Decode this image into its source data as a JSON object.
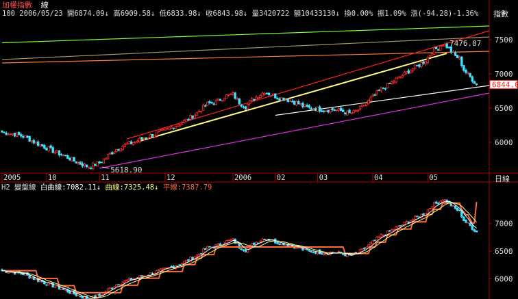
{
  "header": {
    "title": "加權指數",
    "mode": "線",
    "line1_prefix": "100",
    "date": "2006/05/23",
    "open": "開6874.09↓",
    "high": "高6909.58↓",
    "low": "低6833.98↓",
    "close": "收6843.98↓",
    "volume": "量3420722",
    "amount": "額10433130↓",
    "turnover": "換0.00%",
    "amplitude": "振1.09%",
    "change": "漲(-94.28)-1.36%",
    "right_tag": "指數"
  },
  "lower_header": {
    "panel_id": "H2",
    "name": "變盤線",
    "white_label": "白曲線:7082.11↓",
    "yellow_label": "曲線:7325.48↓",
    "red_label": "平線:7387.79"
  },
  "axis": {
    "x_unit_label": "日線",
    "x_ticks": [
      {
        "label": "2005",
        "index": 0
      },
      {
        "label": "10",
        "index": 21
      },
      {
        "label": "11",
        "index": 46
      },
      {
        "label": "12",
        "index": 77
      },
      {
        "label": "2006",
        "index": 109
      },
      {
        "label": "02",
        "index": 129
      },
      {
        "label": "03",
        "index": 149
      },
      {
        "label": "04",
        "index": 175
      },
      {
        "label": "05",
        "index": 201
      }
    ]
  },
  "annotations": {
    "low_label": "5618.90",
    "high_label": "7476.07",
    "last_price_tag": "6844.0"
  },
  "colors": {
    "up": "#ff3030",
    "down": "#40e0ff",
    "axis": "#b00000",
    "text_red": "#ff5050",
    "green_line": "#7cff3a",
    "tan_line": "#a89466",
    "orange_line": "#ff7a3a",
    "red_line": "#ff2020",
    "yellow_line": "#ffff80",
    "white_line": "#ffffff",
    "magenta_line": "#e030e0",
    "step_line": "#ff6a3a"
  },
  "chart_data": [
    {
      "type": "candlestick",
      "title": "加權指數",
      "x_range": [
        0,
        230
      ],
      "ylim": [
        5550,
        7800
      ],
      "y_ticks": [
        6000,
        6500,
        7000,
        7500
      ],
      "keypoints": [
        [
          0,
          6150
        ],
        [
          6,
          6120
        ],
        [
          11,
          6080
        ],
        [
          16,
          5990
        ],
        [
          21,
          5920
        ],
        [
          26,
          5850
        ],
        [
          31,
          5780
        ],
        [
          36,
          5700
        ],
        [
          41,
          5640
        ],
        [
          46,
          5700
        ],
        [
          51,
          5830
        ],
        [
          54,
          5900
        ],
        [
          57,
          5950
        ],
        [
          62,
          6000
        ],
        [
          67,
          6060
        ],
        [
          72,
          6120
        ],
        [
          77,
          6170
        ],
        [
          82,
          6250
        ],
        [
          87,
          6320
        ],
        [
          92,
          6430
        ],
        [
          97,
          6560
        ],
        [
          102,
          6610
        ],
        [
          106,
          6680
        ],
        [
          109,
          6700
        ],
        [
          112,
          6580
        ],
        [
          115,
          6520
        ],
        [
          118,
          6620
        ],
        [
          121,
          6680
        ],
        [
          124,
          6740
        ],
        [
          127,
          6700
        ],
        [
          130,
          6660
        ],
        [
          133,
          6640
        ],
        [
          136,
          6610
        ],
        [
          139,
          6580
        ],
        [
          142,
          6530
        ],
        [
          145,
          6500
        ],
        [
          149,
          6490
        ],
        [
          152,
          6470
        ],
        [
          156,
          6480
        ],
        [
          160,
          6460
        ],
        [
          164,
          6420
        ],
        [
          167,
          6450
        ],
        [
          170,
          6520
        ],
        [
          173,
          6600
        ],
        [
          176,
          6690
        ],
        [
          179,
          6780
        ],
        [
          182,
          6830
        ],
        [
          185,
          6900
        ],
        [
          188,
          6960
        ],
        [
          191,
          7020
        ],
        [
          194,
          7080
        ],
        [
          197,
          7130
        ],
        [
          200,
          7200
        ],
        [
          203,
          7330
        ],
        [
          206,
          7380
        ],
        [
          208,
          7440
        ],
        [
          210,
          7400
        ],
        [
          212,
          7330
        ],
        [
          214,
          7260
        ],
        [
          216,
          7220
        ],
        [
          218,
          7060
        ],
        [
          220,
          6990
        ],
        [
          222,
          6920
        ],
        [
          224,
          6845
        ]
      ],
      "trendlines": [
        {
          "name": "綠線",
          "color": "green_line",
          "points": [
            [
              0,
              7455
            ],
            [
              230,
              7700
            ]
          ]
        },
        {
          "name": "褐線",
          "color": "tan_line",
          "points": [
            [
              0,
              7210
            ],
            [
              230,
              7540
            ]
          ]
        },
        {
          "name": "橘線",
          "color": "orange_line",
          "points": [
            [
              0,
              7160
            ],
            [
              230,
              7330
            ]
          ]
        },
        {
          "name": "紅線",
          "color": "red_line",
          "points": [
            [
              59,
              6050
            ],
            [
              230,
              7630
            ]
          ]
        },
        {
          "name": "黃線",
          "color": "yellow_line",
          "points": [
            [
              64,
              6010
            ],
            [
              210,
              7300
            ]
          ]
        },
        {
          "name": "白線",
          "color": "white_line",
          "points": [
            [
              129,
              6395
            ],
            [
              230,
              6830
            ]
          ]
        },
        {
          "name": "紫線",
          "color": "magenta_line",
          "points": [
            [
              46,
              5620
            ],
            [
              230,
              6720
            ]
          ]
        }
      ]
    },
    {
      "type": "line",
      "title": "變盤線",
      "x_range": [
        0,
        230
      ],
      "ylim": [
        5700,
        7550
      ],
      "y_ticks": [
        6000,
        6500,
        7000
      ],
      "series": [
        {
          "name": "白曲線",
          "color": "white_line",
          "values": [
            7082.11
          ]
        },
        {
          "name": "曲線",
          "color": "yellow_line",
          "values": [
            7325.48
          ]
        },
        {
          "name": "平線",
          "color": "step_line",
          "values": [
            7387.79
          ]
        }
      ]
    }
  ]
}
